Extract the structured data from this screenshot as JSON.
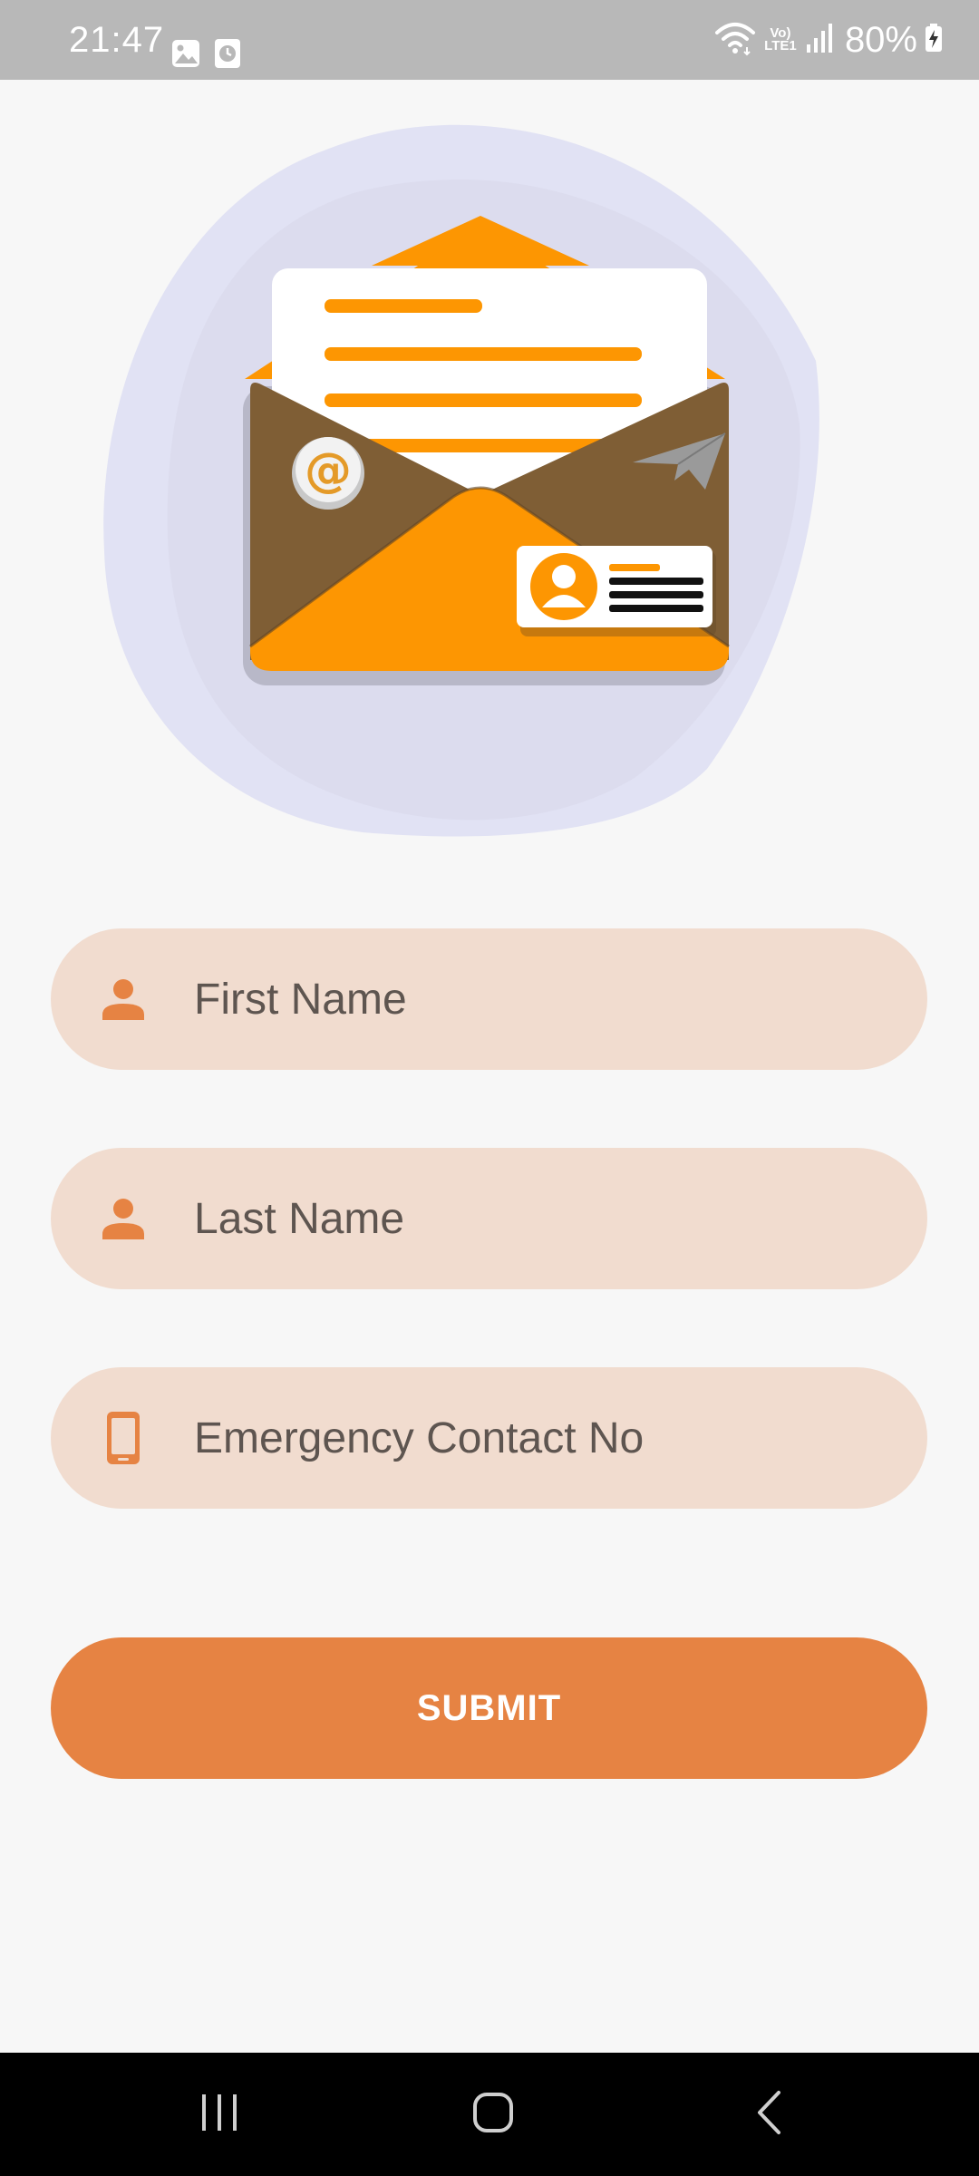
{
  "status_bar": {
    "time": "21:47",
    "battery_percent": "80%",
    "network_label": "Vo) LTE1",
    "left_icons": [
      "gallery-icon",
      "clock-app-icon"
    ],
    "right_icons": [
      "wifi-icon",
      "lte-icon",
      "signal-icon",
      "battery-charging-icon"
    ]
  },
  "illustration": {
    "name": "email-envelope-illustration",
    "colors": {
      "blob": "#e1e2f4",
      "envelope_dark": "#7f5e35",
      "envelope_orange": "#fd9602",
      "letter": "#ffffff",
      "plane": "#9a9a9a"
    }
  },
  "form": {
    "first_name": {
      "placeholder": "First Name",
      "value": "",
      "icon": "person-icon"
    },
    "last_name": {
      "placeholder": "Last Name",
      "value": "",
      "icon": "person-icon"
    },
    "emergency_contact": {
      "placeholder": "Emergency Contact No",
      "value": "",
      "icon": "phone-icon"
    },
    "submit_label": "SUBMIT"
  },
  "theme": {
    "accent": "#e68343",
    "field_background": "#f1dccf",
    "page_background": "#f7f7f7"
  },
  "nav_bar": {
    "buttons": [
      "recent-apps-icon",
      "home-icon",
      "back-icon"
    ]
  }
}
